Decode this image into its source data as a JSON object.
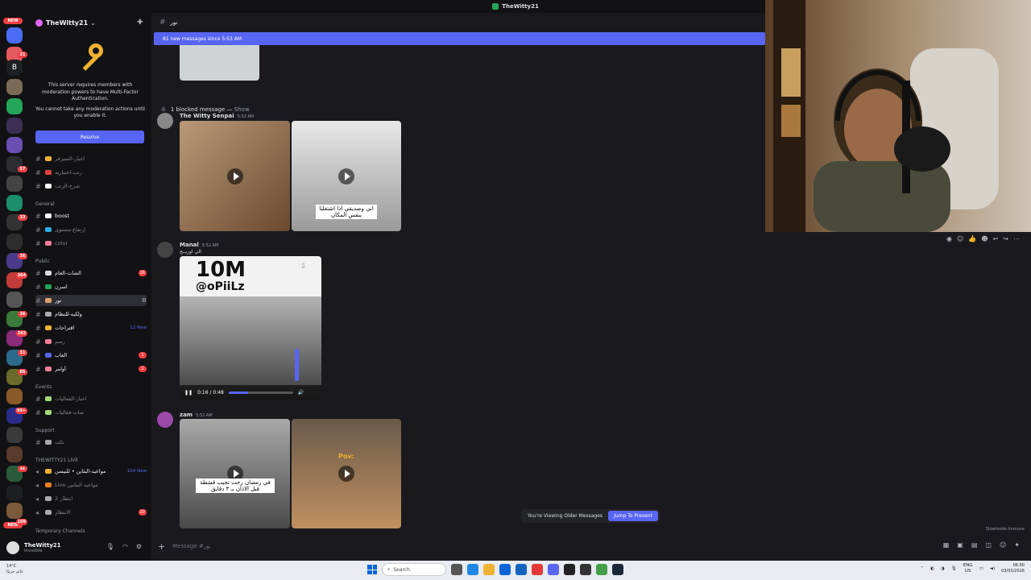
{
  "window": {
    "title": "TheWitty21"
  },
  "rail": {
    "new_badge_top": "NEW",
    "letter_b": "B",
    "new_badge_bottom": "NEW",
    "badges": [
      "21",
      "57",
      "33",
      "36",
      "364",
      "36",
      "343",
      "31",
      "86",
      "99+",
      "ss",
      "109"
    ]
  },
  "server": {
    "name": "TheWitty21",
    "mfa_notice_1": "This server requires members with moderation powers to have Multi-Factor Authentication.",
    "mfa_notice_2": "You cannot take any moderation actions until you enable it.",
    "resolve_label": "Resolve"
  },
  "channels": {
    "top": [
      {
        "name": "اخبار-السيرفر"
      },
      {
        "name": "رتب-اختياريه"
      },
      {
        "name": "شرح-الرتب"
      }
    ],
    "general_label": "General",
    "general": [
      {
        "name": "boost"
      },
      {
        "name": "إرتفاع-مستوى"
      },
      {
        "name": "color"
      }
    ],
    "public_label": "Public",
    "public": [
      {
        "name": "الشات-العام",
        "count": "26"
      },
      {
        "name": "اسرن"
      },
      {
        "name": "نور"
      },
      {
        "name": "ولكبه-للنظام"
      },
      {
        "name": "اقتراحات",
        "newtag": "12 New"
      },
      {
        "name": "رسم"
      },
      {
        "name": "العاب",
        "count": "1"
      },
      {
        "name": "أوامر",
        "count": "1"
      }
    ],
    "events_label": "Events",
    "events": [
      {
        "name": "اخبار-الفعاليات"
      },
      {
        "name": "شات-فعاليات"
      }
    ],
    "support_label": "Support",
    "support": [
      {
        "name": "تكت"
      }
    ],
    "live_label": "THEWITTY21 LIVE",
    "live": [
      {
        "name": "مواعيد-البثاين • للبيسن",
        "newtag": "104 New"
      },
      {
        "name": "Live مواعيد البثابين"
      },
      {
        "name": "انتظار 2"
      },
      {
        "name": "الانتظار",
        "count": "20"
      }
    ],
    "temp_label": "Temporary Channels"
  },
  "user_panel": {
    "name": "TheWitty21",
    "status": "Invisible"
  },
  "chat": {
    "channel_name": "نور",
    "new_messages_bar": "81 new messages since 5:53 AM",
    "blocked_text": "1 blocked message —",
    "blocked_show": "Show",
    "messages": [
      {
        "author": "The Witty Senpai",
        "time": "5:52 AM",
        "caption": "اني وصديقي اذا اشتغلنا بنفس المكان"
      },
      {
        "author": "Manal",
        "time": "5:52 AM",
        "subtext": "الي اوريــح",
        "video_big": "10M",
        "video_handle": "@oPiiLz",
        "video_time": "0:16 / 0:48"
      },
      {
        "author": "zam",
        "time": "5:52 AM",
        "caption": "في رمضان رحت تجيب قشطة قبل الاذان بـ ٣ دقايق",
        "caption2": "Pov:"
      }
    ],
    "older_notice": "You're Viewing Older Messages",
    "jump_label": "Jump To Present",
    "slowmode": "Slowmode Immune",
    "composer_placeholder": "Message #نور"
  },
  "taskbar": {
    "weather_temp": "14°C",
    "weather_desc": "غائم جزئيًا",
    "search_placeholder": "Search",
    "lang": "ENG",
    "lang2": "US",
    "time": "06:00",
    "date": "03/03/2026"
  },
  "colors": {
    "accent": "#5865f2",
    "danger": "#f23f43",
    "bg": "#1a1a1e",
    "sidebar": "#121214"
  }
}
